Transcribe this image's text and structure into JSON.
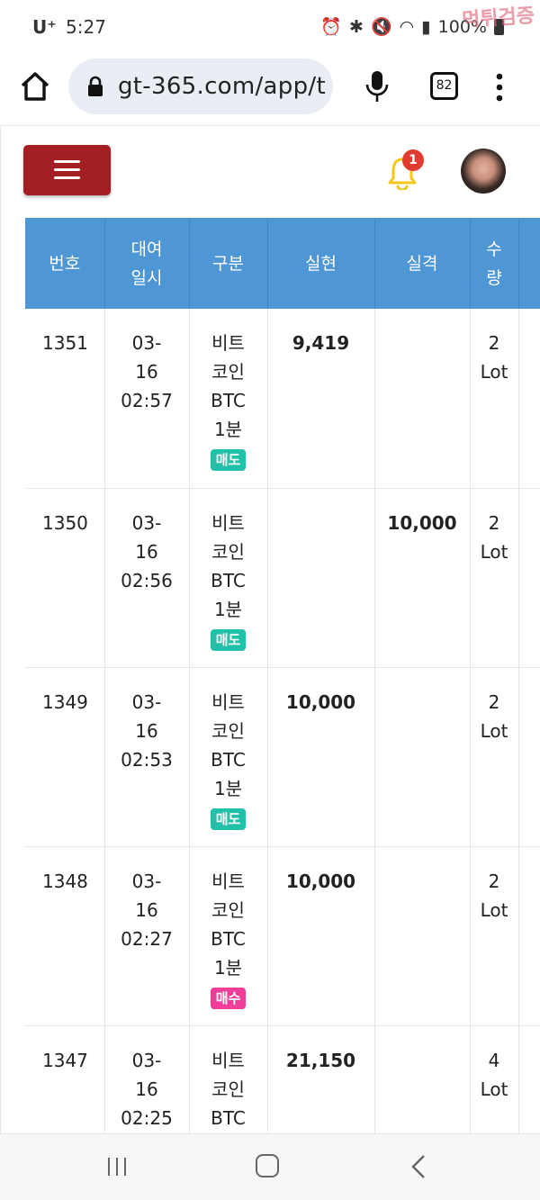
{
  "status_bar": {
    "carrier": "U⁺",
    "time": "5:27",
    "battery": "100%",
    "watermark": "먹튀검증"
  },
  "browser": {
    "url": "gt-365.com/app/t",
    "tab_count": "82"
  },
  "header": {
    "notification_count": "1"
  },
  "table": {
    "headers": {
      "no": "번호",
      "date_line1": "대여",
      "date_line2": "일시",
      "type": "구분",
      "realized": "실현",
      "lost": "실격",
      "qty_line1": "수",
      "qty_line2": "량"
    },
    "rows": [
      {
        "no": "1351",
        "date1": "03-",
        "date2": "16",
        "date3": "02:57",
        "type1": "비트",
        "type2": "코인",
        "type3": "BTC",
        "type4": "1분",
        "badge": "매도",
        "badge_kind": "sell",
        "realized": "9,419",
        "lost": "",
        "qty": "2",
        "unit": "Lot"
      },
      {
        "no": "1350",
        "date1": "03-",
        "date2": "16",
        "date3": "02:56",
        "type1": "비트",
        "type2": "코인",
        "type3": "BTC",
        "type4": "1분",
        "badge": "매도",
        "badge_kind": "sell",
        "realized": "",
        "lost": "10,000",
        "qty": "2",
        "unit": "Lot"
      },
      {
        "no": "1349",
        "date1": "03-",
        "date2": "16",
        "date3": "02:53",
        "type1": "비트",
        "type2": "코인",
        "type3": "BTC",
        "type4": "1분",
        "badge": "매도",
        "badge_kind": "sell",
        "realized": "10,000",
        "lost": "",
        "qty": "2",
        "unit": "Lot"
      },
      {
        "no": "1348",
        "date1": "03-",
        "date2": "16",
        "date3": "02:27",
        "type1": "비트",
        "type2": "코인",
        "type3": "BTC",
        "type4": "1분",
        "badge": "매수",
        "badge_kind": "buy",
        "realized": "10,000",
        "lost": "",
        "qty": "2",
        "unit": "Lot"
      },
      {
        "no": "1347",
        "date1": "03-",
        "date2": "16",
        "date3": "02:25",
        "type1": "비트",
        "type2": "코인",
        "type3": "BTC",
        "type4": "",
        "badge": "",
        "badge_kind": "",
        "realized": "21,150",
        "lost": "",
        "qty": "4",
        "unit": "Lot"
      }
    ]
  },
  "colors": {
    "header_bg": "#4e96d4",
    "menu_button": "#a31f24",
    "realized": "#4fb4a0",
    "lost": "#c9393d",
    "sell_badge": "#1fc2a8",
    "buy_badge": "#f13d9a"
  },
  "icons": {
    "home": "home-icon",
    "lock": "lock-icon",
    "mic": "mic-icon",
    "tabs": "tabs-icon",
    "menu": "overflow-menu-icon",
    "bell": "bell-icon",
    "nav_recent": "recent-apps-icon",
    "nav_home": "nav-home-icon",
    "nav_back": "back-icon"
  }
}
